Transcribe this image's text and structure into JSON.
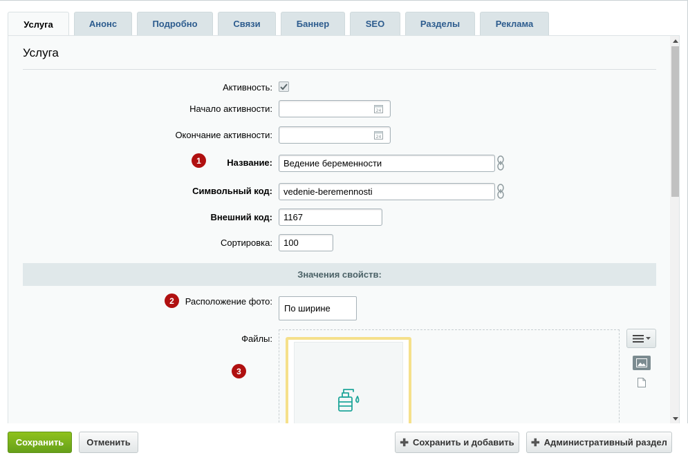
{
  "tabs": [
    {
      "label": "Услуга",
      "active": true
    },
    {
      "label": "Анонс"
    },
    {
      "label": "Подробно"
    },
    {
      "label": "Связи"
    },
    {
      "label": "Баннер"
    },
    {
      "label": "SEO"
    },
    {
      "label": "Разделы"
    },
    {
      "label": "Реклама"
    }
  ],
  "panel": {
    "title": "Услуга"
  },
  "fields": {
    "active": {
      "label": "Активность:",
      "checked": true
    },
    "active_from": {
      "label": "Начало активности:",
      "value": ""
    },
    "active_to": {
      "label": "Окончание активности:",
      "value": ""
    },
    "name": {
      "label": "Название:",
      "value": "Ведение беременности"
    },
    "code": {
      "label": "Символьный код:",
      "value": "vedenie-beremennosti"
    },
    "xml_id": {
      "label": "Внешний код:",
      "value": "1167"
    },
    "sort": {
      "label": "Сортировка:",
      "value": "100"
    }
  },
  "properties": {
    "section_title": "Значения свойств:",
    "photo_position": {
      "label": "Расположение фото:",
      "value": "По ширине"
    },
    "files": {
      "label": "Файлы:"
    }
  },
  "badges": [
    "1",
    "2",
    "3"
  ],
  "icons": {
    "calendar": "calendar-icon",
    "link": "chain-link-icon",
    "menu": "hamburger-menu-icon",
    "image": "image-icon",
    "document": "document-icon",
    "file_preview": "spray-bottle-icon"
  },
  "footer": {
    "save": "Сохранить",
    "cancel": "Отменить",
    "save_add": "Сохранить и добавить",
    "admin": "Административный раздел"
  },
  "colors": {
    "accent_green": "#7fb21c",
    "tab_text": "#2d5c8e",
    "badge_red": "#b01010",
    "highlight_yellow": "#f5e08b",
    "file_icon_teal": "#1fa69a"
  }
}
